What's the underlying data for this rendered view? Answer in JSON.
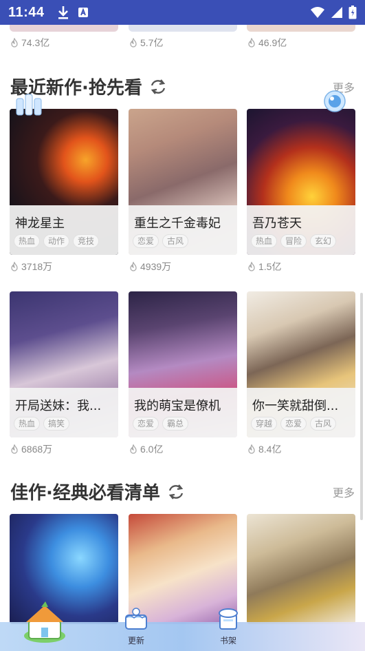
{
  "status_bar": {
    "time": "11:44",
    "icons": [
      "download-icon",
      "a-badge-icon",
      "wifi-icon",
      "signal-icon",
      "battery-icon"
    ],
    "background": "#3a4fb6"
  },
  "top_row": {
    "views": [
      "74.3亿",
      "5.7亿",
      "46.9亿"
    ]
  },
  "section1": {
    "title": "最近新作·抢先看",
    "more": "更多",
    "items": [
      {
        "title": "神龙星主",
        "tags": [
          "热血",
          "动作",
          "竞技"
        ],
        "views": "3718万"
      },
      {
        "title": "重生之千金毒妃",
        "tags": [
          "恋爱",
          "古风"
        ],
        "views": "4939万"
      },
      {
        "title": "吾乃苍天",
        "tags": [
          "热血",
          "冒险",
          "玄幻"
        ],
        "views": "1.5亿"
      },
      {
        "title": "开局送妹：我...",
        "tags": [
          "热血",
          "搞笑"
        ],
        "views": "6868万"
      },
      {
        "title": "我的萌宝是僚机",
        "tags": [
          "恋爱",
          "霸总"
        ],
        "views": "6.0亿"
      },
      {
        "title": "你一笑就甜倒...",
        "tags": [
          "穿越",
          "恋爱",
          "古风"
        ],
        "views": "8.4亿"
      }
    ]
  },
  "section2": {
    "title": "佳作·经典必看清单",
    "more": "更多"
  },
  "bottom_nav": {
    "items": [
      {
        "label": "",
        "icon": "home-house-icon"
      },
      {
        "label": "更新",
        "icon": "update-cake-icon"
      },
      {
        "label": "书架",
        "icon": "bookshelf-icon"
      }
    ]
  },
  "colors": {
    "title": "#333333",
    "muted": "#999999",
    "accent": "#3a4fb6"
  }
}
